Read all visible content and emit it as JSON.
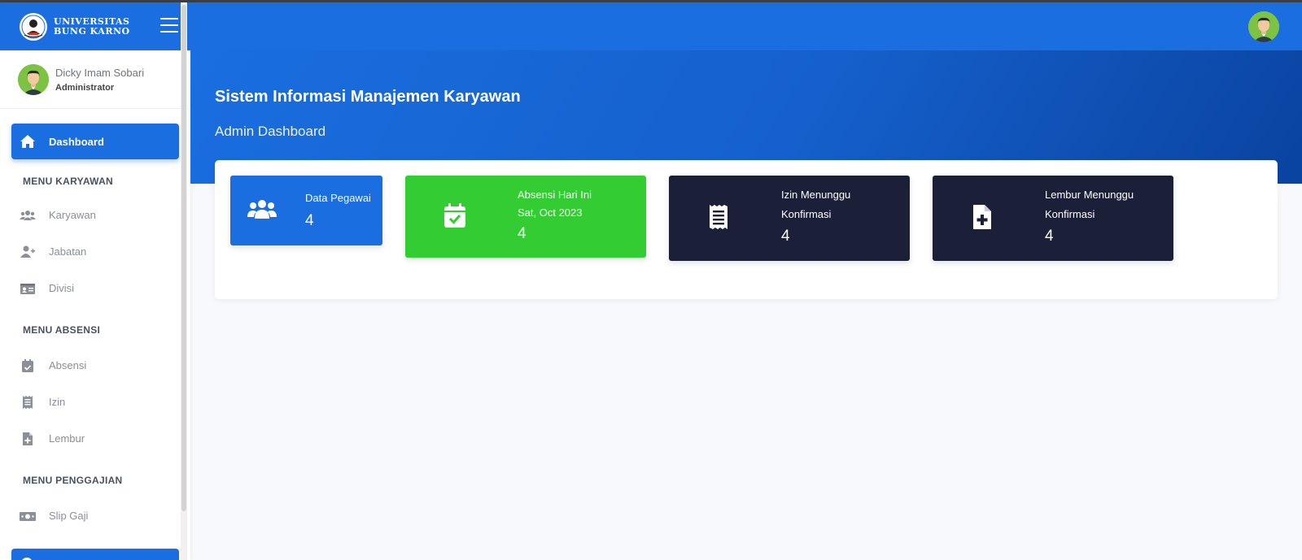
{
  "brand": {
    "line1": "UNIVERSITAS",
    "line2": "BUNG KARNO"
  },
  "user": {
    "name": "Dicky Imam Sobari",
    "role": "Administrator"
  },
  "sidebar": {
    "active": {
      "label": "Dashboard",
      "icon": "home-icon"
    },
    "sections": [
      {
        "title": "MENU KARYAWAN",
        "items": [
          {
            "label": "Karyawan",
            "icon": "users-icon"
          },
          {
            "label": "Jabatan",
            "icon": "user-plus-icon"
          },
          {
            "label": "Divisi",
            "icon": "id-card-icon"
          }
        ]
      },
      {
        "title": "MENU ABSENSI",
        "items": [
          {
            "label": "Absensi",
            "icon": "calendar-check-icon"
          },
          {
            "label": "Izin",
            "icon": "receipt-icon"
          },
          {
            "label": "Lembur",
            "icon": "file-medical-icon"
          }
        ]
      },
      {
        "title": "MENU PENGGAJIAN",
        "items": [
          {
            "label": "Slip Gaji",
            "icon": "money-bill-icon"
          }
        ]
      }
    ]
  },
  "header": {
    "title": "Sistem Informasi Manajemen Karyawan",
    "subtitle": "Admin Dashboard"
  },
  "stats": [
    {
      "title": "Data Pegawai",
      "value": "4",
      "icon": "users-icon",
      "color": "#1a6ee0"
    },
    {
      "title": "Absensi Hari Ini",
      "subtitle": "Sat, Oct 2023",
      "value": "4",
      "icon": "calendar-check-icon",
      "color": "#33cc33"
    },
    {
      "title_line1": "Izin Menunggu",
      "title_line2": "Konfirmasi",
      "value": "4",
      "icon": "receipt-icon",
      "color": "#1b2038"
    },
    {
      "title_line1": "Lembur Menunggu",
      "title_line2": "Konfirmasi",
      "value": "4",
      "icon": "file-medical-icon",
      "color": "#1b2038"
    }
  ],
  "colors": {
    "primary": "#1a6ee0",
    "success": "#33cc33",
    "dark": "#1b2038",
    "background": "#f8f9fc"
  }
}
